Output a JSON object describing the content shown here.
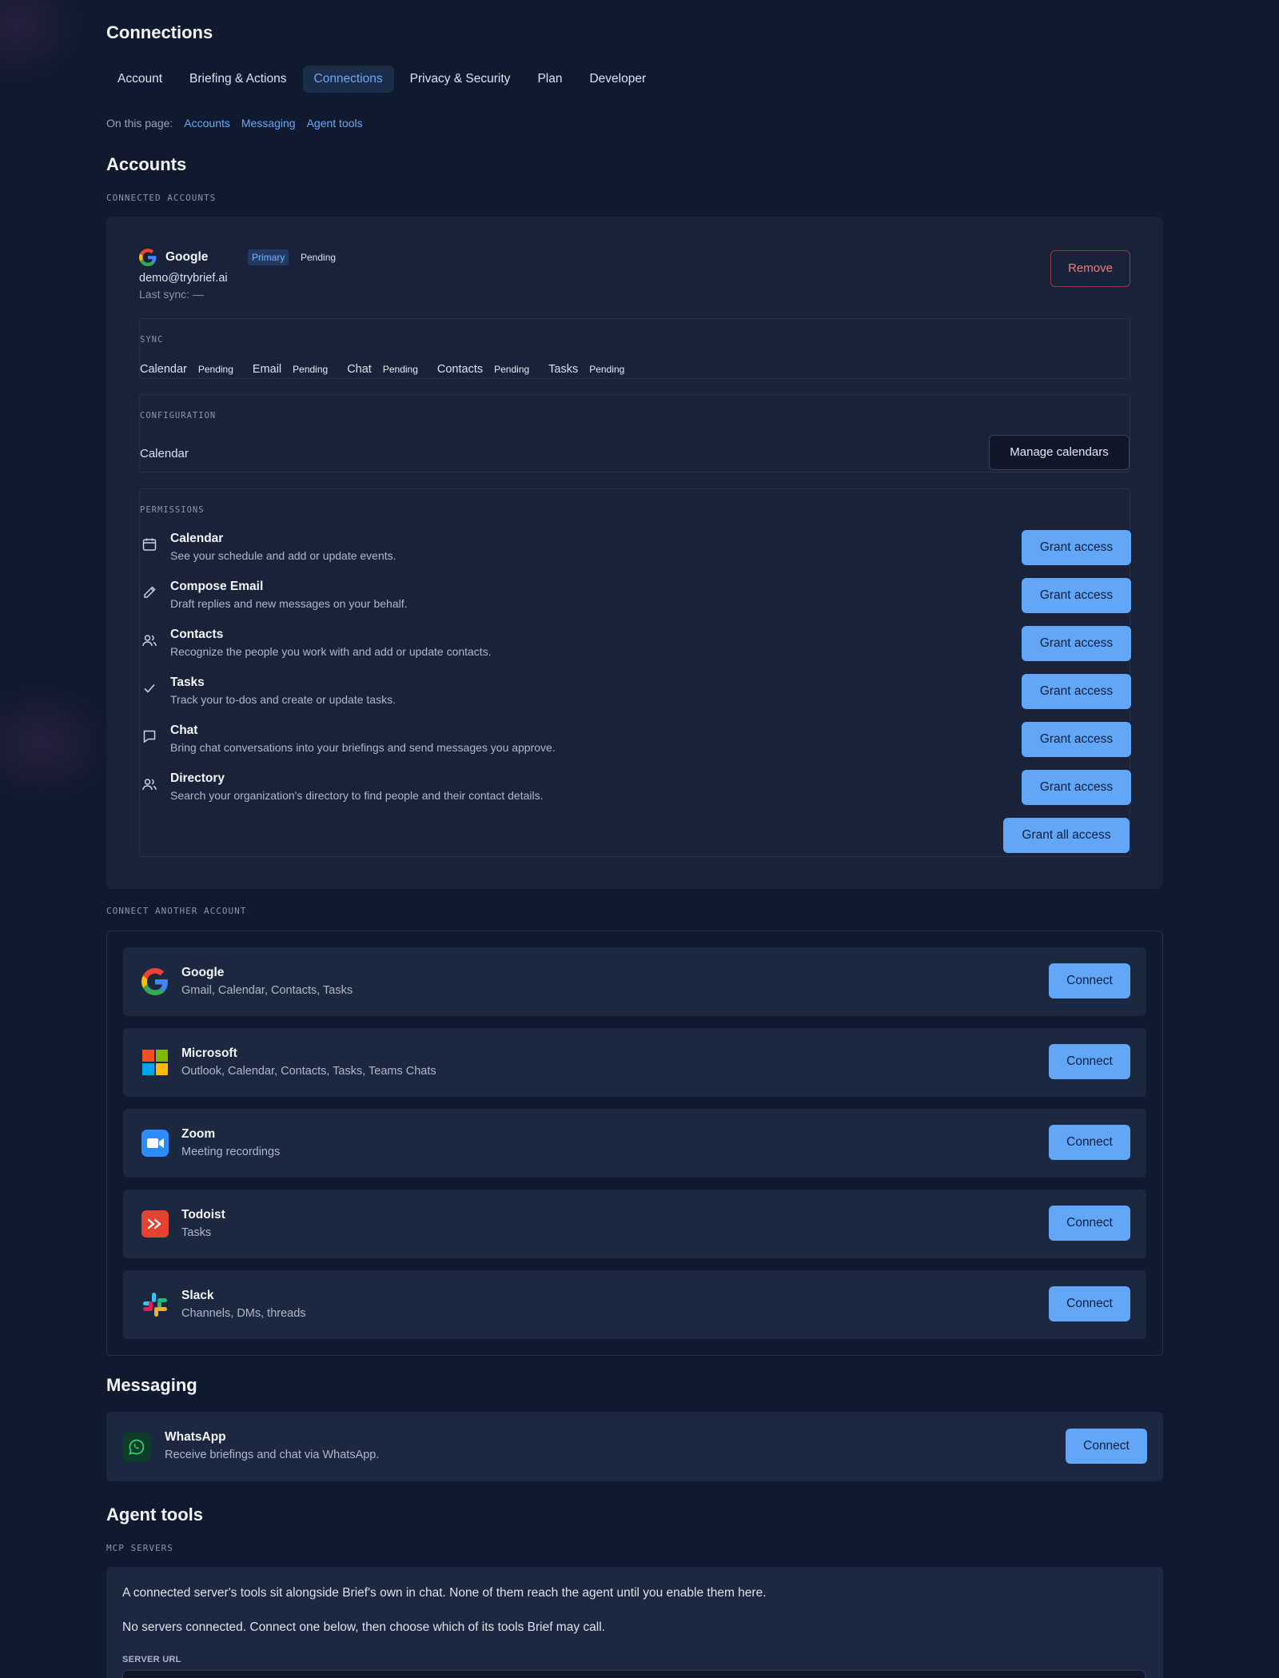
{
  "page": {
    "title": "Connections"
  },
  "tabs": [
    {
      "label": "Account"
    },
    {
      "label": "Briefing & Actions"
    },
    {
      "label": "Connections",
      "active": true
    },
    {
      "label": "Privacy & Security"
    },
    {
      "label": "Plan"
    },
    {
      "label": "Developer"
    }
  ],
  "on_this_page": {
    "label": "On this page:",
    "links": [
      "Accounts",
      "Messaging",
      "Agent tools"
    ]
  },
  "accounts": {
    "heading": "Accounts",
    "connected_label": "CONNECTED ACCOUNTS",
    "account": {
      "provider": "Google",
      "primary_badge": "Primary",
      "status": "Pending",
      "email": "demo@trybrief.ai",
      "last_sync": "Last sync: —",
      "remove_label": "Remove"
    },
    "sync": {
      "label": "SYNC",
      "items": [
        {
          "name": "Calendar",
          "status": "Pending"
        },
        {
          "name": "Email",
          "status": "Pending"
        },
        {
          "name": "Chat",
          "status": "Pending"
        },
        {
          "name": "Contacts",
          "status": "Pending"
        },
        {
          "name": "Tasks",
          "status": "Pending"
        }
      ]
    },
    "configuration": {
      "label": "CONFIGURATION",
      "item": "Calendar",
      "button": "Manage calendars"
    },
    "permissions": {
      "label": "PERMISSIONS",
      "items": [
        {
          "icon": "calendar-icon",
          "title": "Calendar",
          "desc": "See your schedule and add or update events.",
          "button": "Grant access"
        },
        {
          "icon": "pencil-icon",
          "title": "Compose Email",
          "desc": "Draft replies and new messages on your behalf.",
          "button": "Grant access"
        },
        {
          "icon": "users-icon",
          "title": "Contacts",
          "desc": "Recognize the people you work with and add or update contacts.",
          "button": "Grant access"
        },
        {
          "icon": "check-icon",
          "title": "Tasks",
          "desc": "Track your to-dos and create or update tasks.",
          "button": "Grant access"
        },
        {
          "icon": "chat-bubble-icon",
          "title": "Chat",
          "desc": "Bring chat conversations into your briefings and send messages you approve.",
          "button": "Grant access"
        },
        {
          "icon": "users-icon",
          "title": "Directory",
          "desc": "Search your organization's directory to find people and their contact details.",
          "button": "Grant access"
        }
      ],
      "grant_all": "Grant all access"
    },
    "connect_label": "CONNECT ANOTHER ACCOUNT",
    "providers": [
      {
        "name": "Google",
        "desc": "Gmail, Calendar, Contacts, Tasks",
        "button": "Connect",
        "icon": "google-logo-icon"
      },
      {
        "name": "Microsoft",
        "desc": "Outlook, Calendar, Contacts, Tasks, Teams Chats",
        "button": "Connect",
        "icon": "microsoft-logo-icon"
      },
      {
        "name": "Zoom",
        "desc": "Meeting recordings",
        "button": "Connect",
        "icon": "zoom-logo-icon"
      },
      {
        "name": "Todoist",
        "desc": "Tasks",
        "button": "Connect",
        "icon": "todoist-logo-icon"
      },
      {
        "name": "Slack",
        "desc": "Channels, DMs, threads",
        "button": "Connect",
        "icon": "slack-logo-icon"
      }
    ]
  },
  "messaging": {
    "heading": "Messaging",
    "whatsapp": {
      "name": "WhatsApp",
      "desc": "Receive briefings and chat via WhatsApp.",
      "button": "Connect"
    }
  },
  "agent_tools": {
    "heading": "Agent tools",
    "mcp_label": "MCP SERVERS",
    "intro": "A connected server's tools sit alongside Brief's own in chat. None of them reach the agent until you enable them here.",
    "empty": "No servers connected. Connect one below, then choose which of its tools Brief may call.",
    "server_url_label": "SERVER URL",
    "server_url_value": ""
  },
  "colors": {
    "background": "#101a2e",
    "card": "#18233a",
    "accent": "#62a6f7",
    "link": "#6aa8f7",
    "danger": "#f07a80"
  }
}
